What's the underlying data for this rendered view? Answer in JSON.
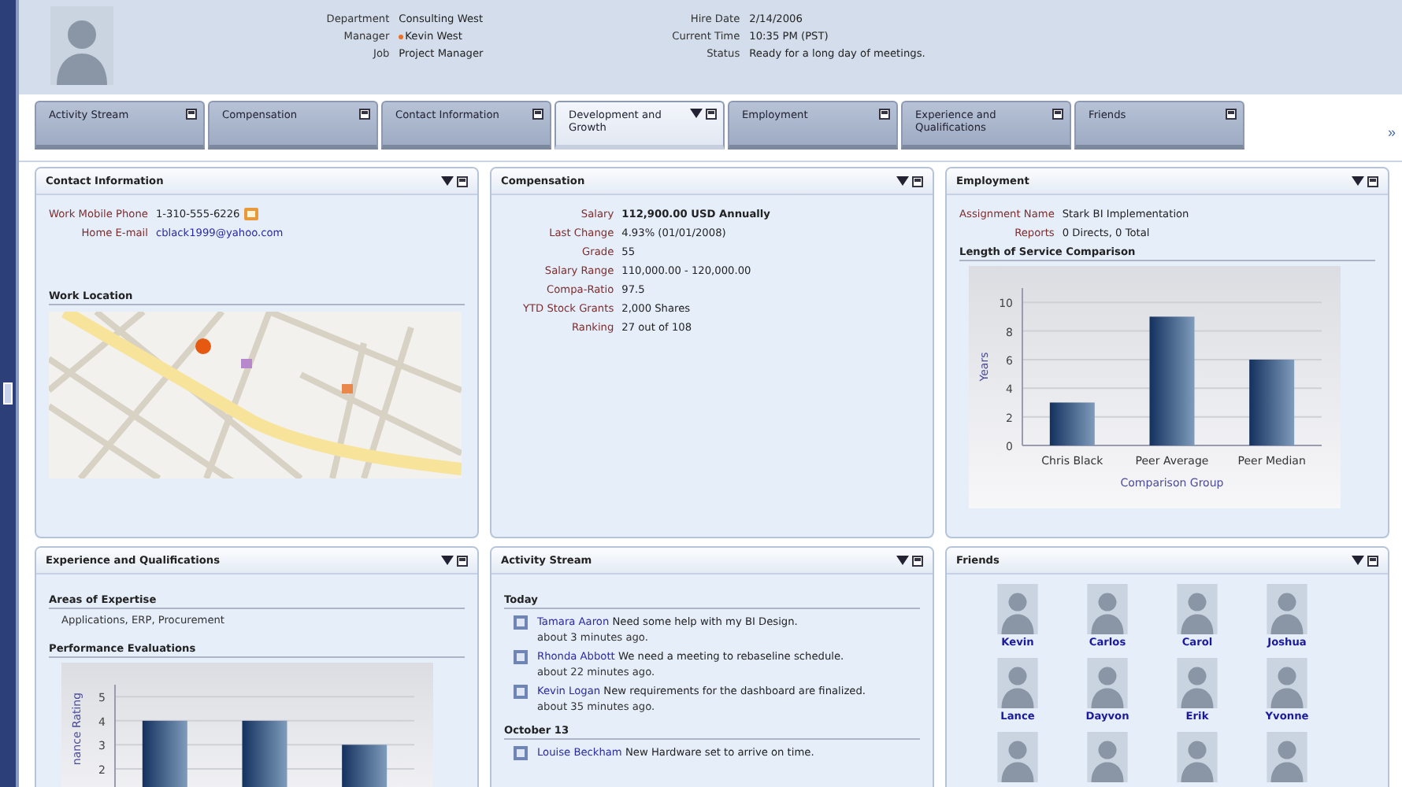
{
  "header": {
    "fields_left": [
      {
        "label": "Department",
        "value": "Consulting West",
        "presence": false
      },
      {
        "label": "Manager",
        "value": "Kevin West",
        "presence": true
      },
      {
        "label": "Job",
        "value": "Project Manager",
        "presence": false
      }
    ],
    "fields_right": [
      {
        "label": "Hire Date",
        "value": "2/14/2006"
      },
      {
        "label": "Current Time",
        "value": "10:35 PM (PST)"
      },
      {
        "label": "Status",
        "value": "Ready for a long day of meetings."
      }
    ]
  },
  "tabs": [
    {
      "label": "Activity Stream",
      "selected": false
    },
    {
      "label": "Compensation",
      "selected": false
    },
    {
      "label": "Contact Information",
      "selected": false
    },
    {
      "label": "Development and Growth",
      "selected": true
    },
    {
      "label": "Employment",
      "selected": false
    },
    {
      "label": "Experience and Qualifications",
      "selected": false
    },
    {
      "label": "Friends",
      "selected": false
    }
  ],
  "tabs_more": "»",
  "panels": [
    {
      "kind": "contact",
      "title": "Contact Information",
      "fields": [
        {
          "label": "Work Mobile Phone",
          "value": "1-310-555-6226",
          "kind": "phone"
        },
        {
          "label": "Home E-mail",
          "value": "cblack1999@yahoo.com",
          "kind": "email"
        }
      ],
      "section": "Work Location"
    },
    {
      "kind": "fields",
      "title": "Compensation",
      "fields": [
        {
          "label": "Salary",
          "value": "112,900.00 USD Annually",
          "emphasis": true
        },
        {
          "label": "Last Change",
          "value": "4.93% (01/01/2008)",
          "emphasis": false
        },
        {
          "label": "Grade",
          "value": "55",
          "emphasis": false
        },
        {
          "label": "Salary Range",
          "value": "110,000.00 - 120,000.00",
          "emphasis": false
        },
        {
          "label": "Compa-Ratio",
          "value": "97.5",
          "emphasis": false
        },
        {
          "label": "YTD Stock Grants",
          "value": "2,000 Shares",
          "emphasis": false
        },
        {
          "label": "Ranking",
          "value": "27 out of 108",
          "emphasis": false
        }
      ]
    },
    {
      "kind": "employment",
      "title": "Employment",
      "fields": [
        {
          "label": "Assignment Name",
          "value": "Stark BI Implementation"
        },
        {
          "label": "Reports",
          "value": "0 Directs, 0 Total"
        }
      ],
      "section": "Length of Service Comparison",
      "chart_data": {
        "type": "bar",
        "xlabel": "Comparison Group",
        "ylabel": "Years",
        "categories": [
          "Chris Black",
          "Peer Average",
          "Peer Median"
        ],
        "values": [
          3,
          9,
          6
        ],
        "yticks": [
          0,
          2,
          4,
          6,
          8,
          10
        ],
        "ylim": [
          0,
          11
        ],
        "grid": true
      }
    },
    {
      "kind": "experience",
      "title": "Experience and Qualifications",
      "heading": "Areas of Expertise",
      "text": "Applications, ERP, Procurement",
      "section": "Performance Evaluations",
      "chart_data": {
        "type": "bar",
        "ylabel": "nance Rating",
        "values": [
          4,
          4,
          3
        ],
        "yticks": [
          2,
          3,
          4,
          5
        ],
        "ylim": [
          0,
          5.5
        ],
        "grid": true
      }
    },
    {
      "kind": "activity",
      "title": "Activity Stream",
      "groups": [
        {
          "heading": "Today",
          "items": [
            {
              "author": "Tamara Aaron",
              "text": "Need some help with my BI Design.",
              "time": "about 3 minutes ago."
            },
            {
              "author": "Rhonda Abbott",
              "text": "We need a meeting to rebaseline schedule.",
              "time": "about 22 minutes ago."
            },
            {
              "author": "Kevin Logan",
              "text": "New requirements for the dashboard are finalized.",
              "time": "about 35 minutes ago."
            }
          ]
        },
        {
          "heading": "October 13",
          "items": [
            {
              "author": "Louise Beckham",
              "text": "New Hardware set to arrive on time."
            }
          ]
        }
      ]
    },
    {
      "kind": "friends",
      "title": "Friends",
      "people": [
        {
          "kind": "named",
          "name": "Kevin"
        },
        {
          "kind": "named",
          "name": "Carlos"
        },
        {
          "kind": "named",
          "name": "Carol"
        },
        {
          "kind": "named",
          "name": "Joshua"
        },
        {
          "kind": "named",
          "name": "Lance"
        },
        {
          "kind": "named",
          "name": "Dayvon"
        },
        {
          "kind": "named",
          "name": "Erik"
        },
        {
          "kind": "named",
          "name": "Yvonne"
        },
        {
          "kind": "unnamed"
        },
        {
          "kind": "unnamed"
        },
        {
          "kind": "unnamed"
        },
        {
          "kind": "unnamed"
        }
      ]
    }
  ]
}
